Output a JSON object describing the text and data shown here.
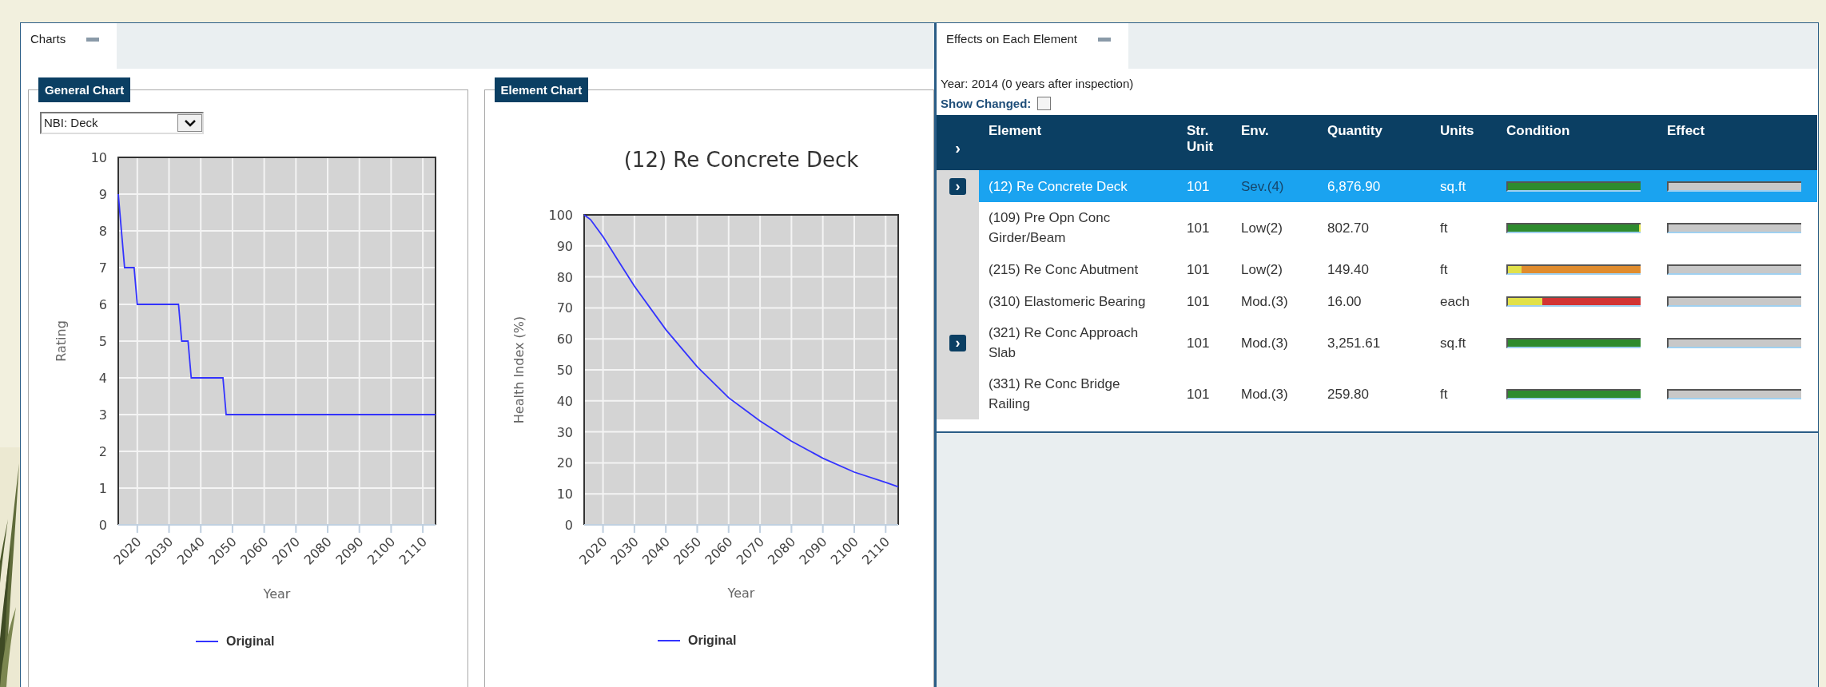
{
  "charts_panel": {
    "tab": {
      "label": "Charts"
    },
    "general_chart": {
      "legend": "General Chart",
      "dropdown": {
        "value": "NBI: Deck"
      },
      "chart_data": {
        "type": "line",
        "xlabel": "Year",
        "ylabel": "Rating",
        "x": [
          2014,
          2016,
          2019,
          2020,
          2033,
          2034,
          2036,
          2037,
          2047,
          2048,
          2114
        ],
        "series": [
          {
            "name": "Original",
            "color": "#3333ff",
            "values": [
              9,
              7,
              7,
              6,
              6,
              5,
              5,
              4,
              4,
              3,
              3
            ]
          }
        ],
        "xlim": [
          2014,
          2114
        ],
        "ylim": [
          0,
          10
        ],
        "grid": true,
        "xticks": [
          2020,
          2030,
          2040,
          2050,
          2060,
          2070,
          2080,
          2090,
          2100,
          2110
        ],
        "yticks": [
          0,
          1,
          2,
          3,
          4,
          5,
          6,
          7,
          8,
          9,
          10
        ]
      }
    },
    "element_chart": {
      "legend": "Element Chart",
      "chart_data": {
        "type": "line",
        "title": "(12) Re Concrete Deck",
        "xlabel": "Year",
        "ylabel": "Health Index (%)",
        "x": [
          2014,
          2016,
          2020,
          2025,
          2030,
          2040,
          2050,
          2060,
          2070,
          2080,
          2090,
          2100,
          2110,
          2114
        ],
        "series": [
          {
            "name": "Original",
            "color": "#3333ff",
            "values": [
              100,
              98.5,
              93,
              85,
              77,
              63,
              51,
              41,
              33.5,
              27,
              21.5,
              17,
              13.7,
              12.3
            ]
          }
        ],
        "xlim": [
          2014,
          2114
        ],
        "ylim": [
          0,
          100
        ],
        "grid": true,
        "xticks": [
          2020,
          2030,
          2040,
          2050,
          2060,
          2070,
          2080,
          2090,
          2100,
          2110
        ],
        "yticks": [
          0,
          10,
          20,
          30,
          40,
          50,
          60,
          70,
          80,
          90,
          100
        ]
      }
    }
  },
  "effects_panel": {
    "tab": {
      "label": "Effects on Each Element"
    },
    "year_text": "Year: 2014 (0 years after inspection)",
    "show_changed": {
      "label": "Show Changed:",
      "checked": false
    },
    "table": {
      "expand_all": "›",
      "columns": [
        "Element",
        "Str. Unit",
        "Env.",
        "Quantity",
        "Units",
        "Condition",
        "Effect"
      ],
      "rows": [
        {
          "selected": true,
          "expander": "›",
          "element": "(12) Re Concrete Deck",
          "str_unit": "101",
          "env": "Sev.(4)",
          "quantity": "6,876.90",
          "units": "sq.ft",
          "condition": [
            {
              "color": "#2e8b2e",
              "level": 1
            }
          ]
        },
        {
          "selected": false,
          "element": "(109) Pre Opn Conc Girder/Beam",
          "str_unit": "101",
          "env": "Low(2)",
          "quantity": "802.70",
          "units": "ft",
          "condition": [
            {
              "color": "#2e8b2e",
              "level": 0.985
            },
            {
              "color": "#e1e14a",
              "level": 0.015
            }
          ]
        },
        {
          "selected": false,
          "element": "(215) Re Conc Abutment",
          "str_unit": "101",
          "env": "Low(2)",
          "quantity": "149.40",
          "units": "ft",
          "condition": [
            {
              "color": "#e1e14a",
              "level": 0.1
            },
            {
              "color": "#e08c2e",
              "level": 0.9
            }
          ]
        },
        {
          "selected": false,
          "element": "(310) Elastomeric Bearing",
          "str_unit": "101",
          "env": "Mod.(3)",
          "quantity": "16.00",
          "units": "each",
          "condition": [
            {
              "color": "#e1e14a",
              "level": 0.26
            },
            {
              "color": "#d23434",
              "level": 0.74
            }
          ]
        },
        {
          "selected": false,
          "expander": "›",
          "element": "(321) Re Conc Approach Slab",
          "str_unit": "101",
          "env": "Mod.(3)",
          "quantity": "3,251.61",
          "units": "sq.ft",
          "condition": [
            {
              "color": "#2e8b2e",
              "level": 1
            }
          ]
        },
        {
          "selected": false,
          "element": "(331) Re Conc Bridge Railing",
          "str_unit": "101",
          "env": "Mod.(3)",
          "quantity": "259.80",
          "units": "ft",
          "condition": [
            {
              "color": "#2e8b2e",
              "level": 1
            }
          ]
        }
      ]
    }
  }
}
